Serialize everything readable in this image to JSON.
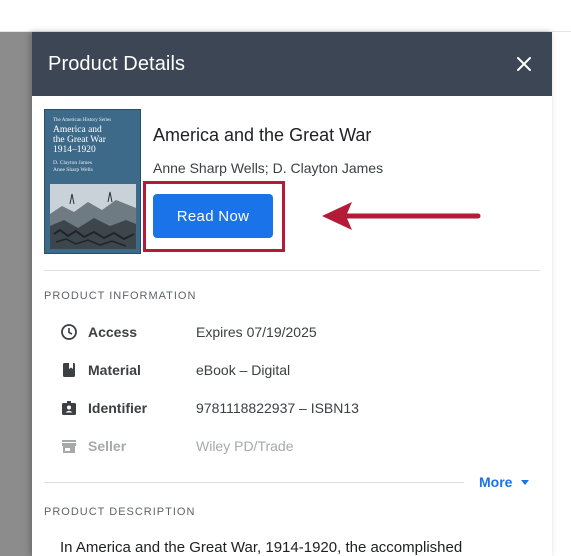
{
  "header": {
    "title": "Product Details",
    "close_icon": "close-icon"
  },
  "book": {
    "cover": {
      "series": "The American History Series",
      "title_line1": "America and",
      "title_line2": "the Great War",
      "title_line3": "1914–1920",
      "author_line1": "D. Clayton James",
      "author_line2": "Anne Sharp Wells",
      "background": "#3e6a8a"
    },
    "title": "America and the Great War",
    "authors": "Anne Sharp Wells; D. Clayton James",
    "read_button": "Read Now"
  },
  "annotation": {
    "highlight_color": "#b31b36"
  },
  "product_information": {
    "label": "PRODUCT INFORMATION",
    "rows": [
      {
        "icon": "clock-icon",
        "key": "Access",
        "value": "Expires 07/19/2025"
      },
      {
        "icon": "book-icon",
        "key": "Material",
        "value": "eBook – Digital"
      },
      {
        "icon": "id-badge-icon",
        "key": "Identifier",
        "value": "9781118822937 – ISBN13"
      },
      {
        "icon": "store-icon",
        "key": "Seller",
        "value": "Wiley PD/Trade"
      }
    ],
    "more_label": "More"
  },
  "product_description": {
    "label": "PRODUCT DESCRIPTION",
    "text": "In America and the Great War, 1914-1920, the accomplished"
  },
  "colors": {
    "header_bg": "#3d4654",
    "accent": "#1a73e8",
    "backdrop": "#8c8c8c"
  }
}
